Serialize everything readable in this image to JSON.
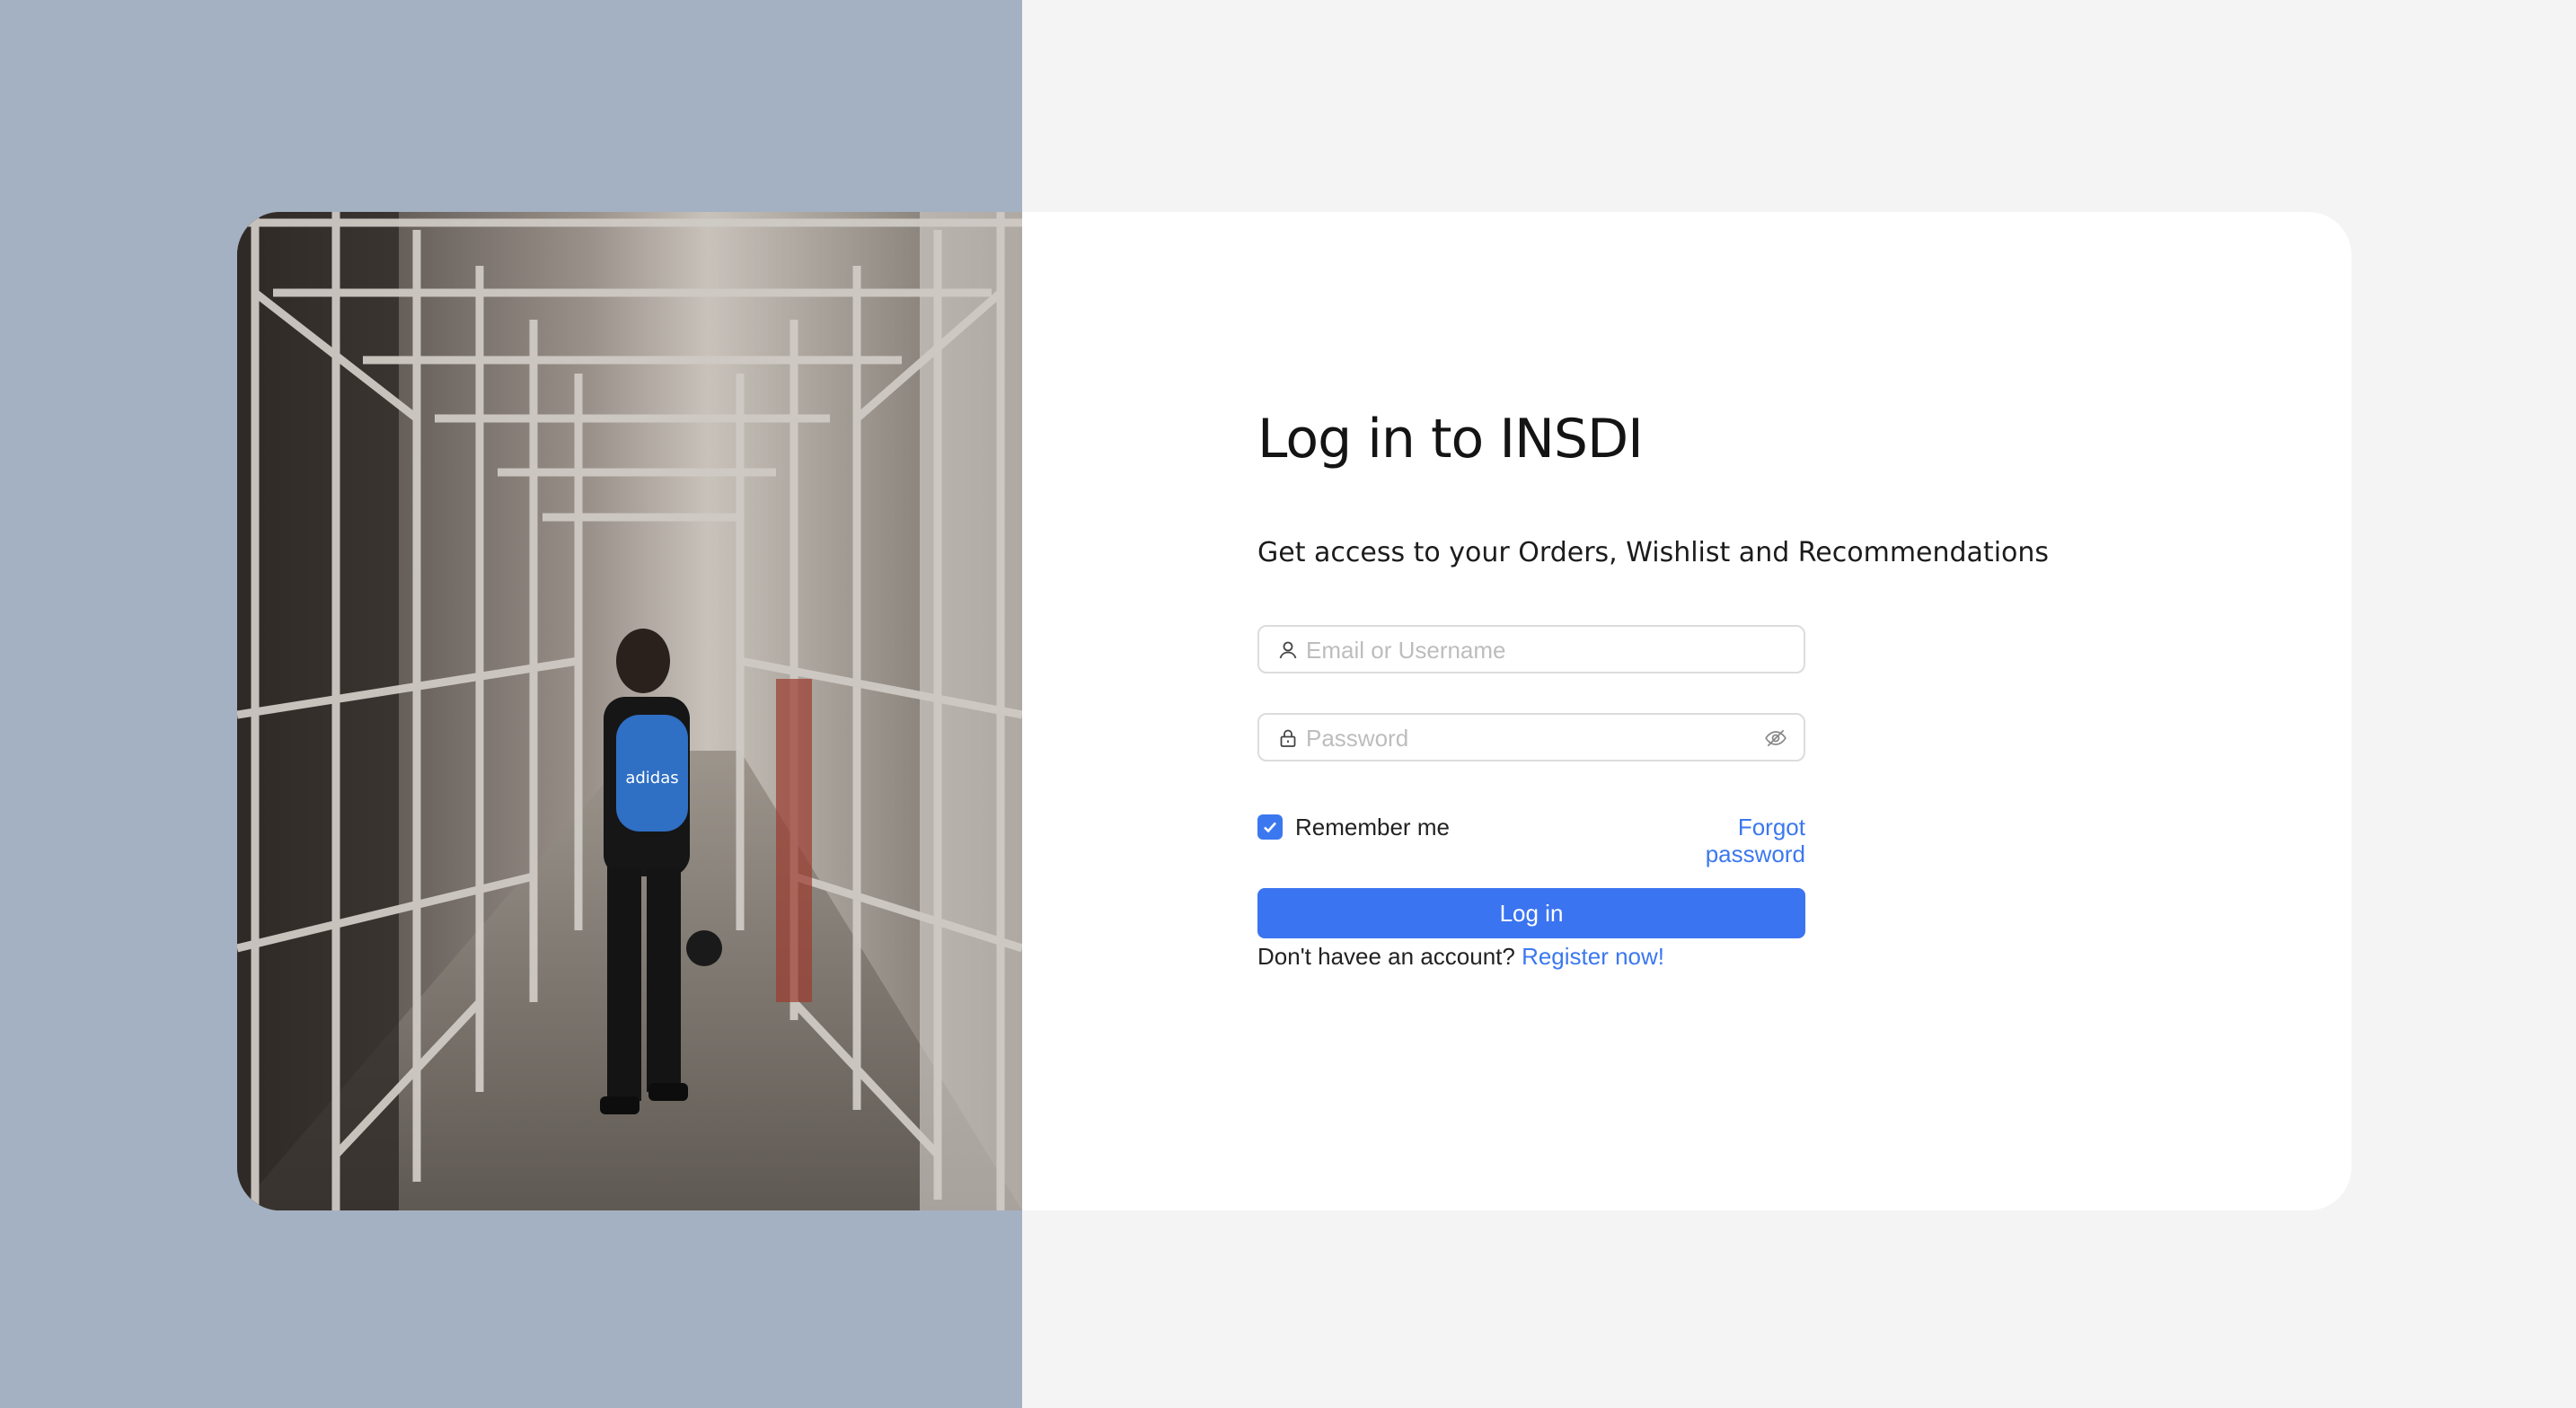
{
  "colors": {
    "left_panel": "#a4b1c2",
    "page_background": "#f4f4f4",
    "card_background": "#ffffff",
    "accent": "#3b74f0"
  },
  "hero": {
    "image": "photo of a person with a blue backpack walking under scaffolding"
  },
  "login": {
    "title": "Log in to INSDI",
    "subtitle": "Get access to your Orders, Wishlist and Recommendations",
    "username_placeholder": "Email or Username",
    "username_icon": "user-icon",
    "password_placeholder": "Password",
    "password_icon": "lock-icon",
    "visibility_icon": "eye-slash-icon",
    "remember_label": "Remember me",
    "remember_checked": true,
    "forgot_label": "Forgot password",
    "submit_label": "Log in",
    "register_prompt": "Don't havee an account?",
    "register_link": "Register now!"
  }
}
